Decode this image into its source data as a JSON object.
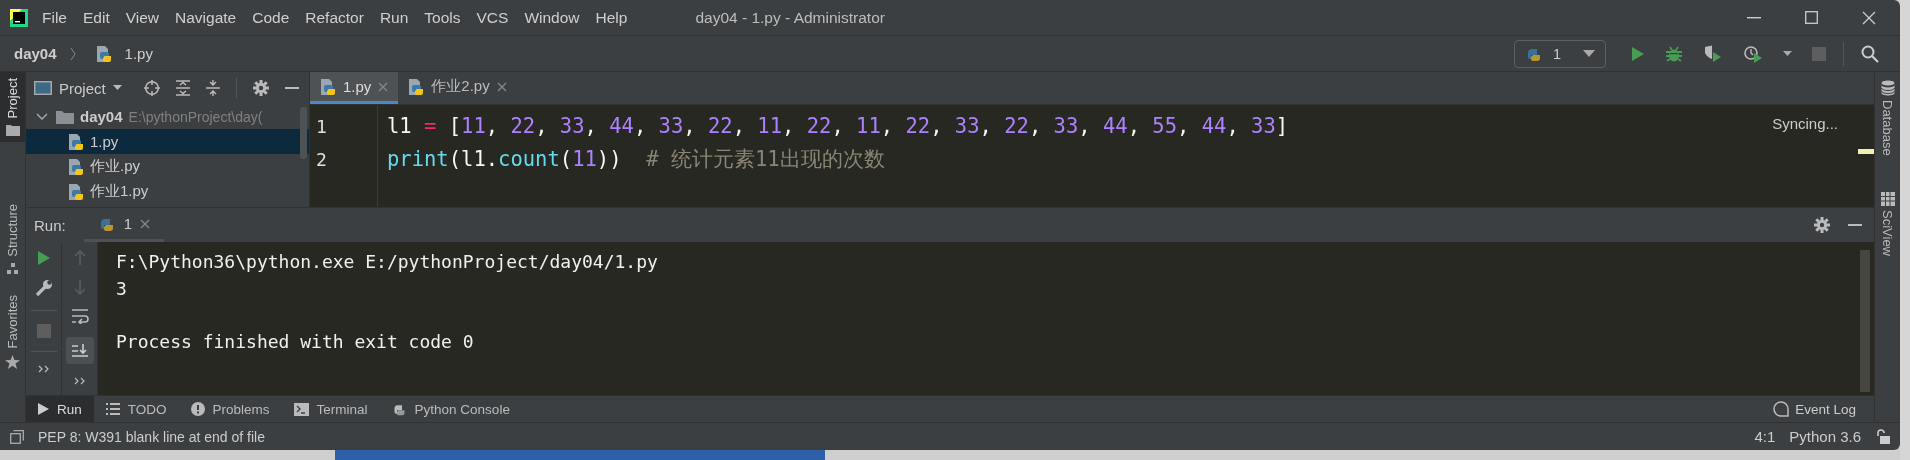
{
  "window": {
    "title": "day04 - 1.py - Administrator"
  },
  "menu": [
    "File",
    "Edit",
    "View",
    "Navigate",
    "Code",
    "Refactor",
    "Run",
    "Tools",
    "VCS",
    "Window",
    "Help"
  ],
  "breadcrumb": {
    "project": "day04",
    "file": "1.py"
  },
  "run_config": {
    "label": "1"
  },
  "left_stripe": [
    {
      "label": "Project",
      "selected": true,
      "kind": "project"
    },
    {
      "label": "Structure",
      "selected": false,
      "kind": "structure"
    },
    {
      "label": "Favorites",
      "selected": false,
      "kind": "favorites"
    }
  ],
  "right_stripe": [
    {
      "label": "Database",
      "kind": "database"
    },
    {
      "label": "SciView",
      "kind": "sciview"
    }
  ],
  "project_panel": {
    "title": "Project",
    "tree": [
      {
        "name": "day04",
        "path": "E:\\pythonProject\\day(",
        "expanded": true,
        "selected": false,
        "children": [
          {
            "name": "1.py",
            "selected": true
          },
          {
            "name": "作业.py",
            "selected": false
          },
          {
            "name": "作业1.py",
            "selected": false
          }
        ]
      }
    ]
  },
  "editor_tabs": [
    {
      "label": "1.py",
      "selected": true
    },
    {
      "label": "作业2.py",
      "selected": false
    }
  ],
  "editor": {
    "status": "Syncing...",
    "lines": [
      {
        "number": "1",
        "tokens": [
          {
            "kind": "id",
            "t": "l1 "
          },
          {
            "kind": "op",
            "t": "="
          },
          {
            "kind": "id",
            "t": " ["
          },
          {
            "kind": "num",
            "t": "11"
          },
          {
            "kind": "id",
            "t": ", "
          },
          {
            "kind": "num",
            "t": "22"
          },
          {
            "kind": "id",
            "t": ", "
          },
          {
            "kind": "num",
            "t": "33"
          },
          {
            "kind": "id",
            "t": ", "
          },
          {
            "kind": "num",
            "t": "44"
          },
          {
            "kind": "id",
            "t": ", "
          },
          {
            "kind": "num",
            "t": "33"
          },
          {
            "kind": "id",
            "t": ", "
          },
          {
            "kind": "num",
            "t": "22"
          },
          {
            "kind": "id",
            "t": ", "
          },
          {
            "kind": "num",
            "t": "11"
          },
          {
            "kind": "id",
            "t": ", "
          },
          {
            "kind": "num",
            "t": "22"
          },
          {
            "kind": "id",
            "t": ", "
          },
          {
            "kind": "num",
            "t": "11"
          },
          {
            "kind": "id",
            "t": ", "
          },
          {
            "kind": "num",
            "t": "22"
          },
          {
            "kind": "id",
            "t": ", "
          },
          {
            "kind": "num",
            "t": "33"
          },
          {
            "kind": "id",
            "t": ", "
          },
          {
            "kind": "num",
            "t": "22"
          },
          {
            "kind": "id",
            "t": ", "
          },
          {
            "kind": "num",
            "t": "33"
          },
          {
            "kind": "id",
            "t": ", "
          },
          {
            "kind": "num",
            "t": "44"
          },
          {
            "kind": "id",
            "t": ", "
          },
          {
            "kind": "num",
            "t": "55"
          },
          {
            "kind": "id",
            "t": ", "
          },
          {
            "kind": "num",
            "t": "44"
          },
          {
            "kind": "id",
            "t": ", "
          },
          {
            "kind": "num",
            "t": "33"
          },
          {
            "kind": "id",
            "t": "]"
          }
        ]
      },
      {
        "number": "2",
        "tokens": [
          {
            "kind": "call",
            "t": "print"
          },
          {
            "kind": "id",
            "t": "(l1."
          },
          {
            "kind": "call",
            "t": "count"
          },
          {
            "kind": "id",
            "t": "("
          },
          {
            "kind": "num",
            "t": "11"
          },
          {
            "kind": "id",
            "t": "))"
          },
          {
            "kind": "comment",
            "t": "  # 统计元素11出现的次数"
          }
        ]
      }
    ]
  },
  "run_panel": {
    "title": "Run:",
    "tab": "1",
    "output": [
      [
        "F:\\Python36\\python.exe E:/pythonProject/day04/1.py",
        "3"
      ],
      [
        "Process finished with exit code 0"
      ]
    ]
  },
  "bottom_tabs": [
    {
      "label": "Run",
      "kind": "run",
      "selected": true
    },
    {
      "label": "TODO",
      "kind": "todo",
      "selected": false
    },
    {
      "label": "Problems",
      "kind": "problems",
      "selected": false
    },
    {
      "label": "Terminal",
      "kind": "terminal",
      "selected": false
    },
    {
      "label": "Python Console",
      "kind": "console",
      "selected": false
    }
  ],
  "event_log": "Event Log",
  "status_bar": {
    "message": "PEP 8: W391 blank line at end of file",
    "position": "4:1",
    "interpreter": "Python 3.6"
  }
}
